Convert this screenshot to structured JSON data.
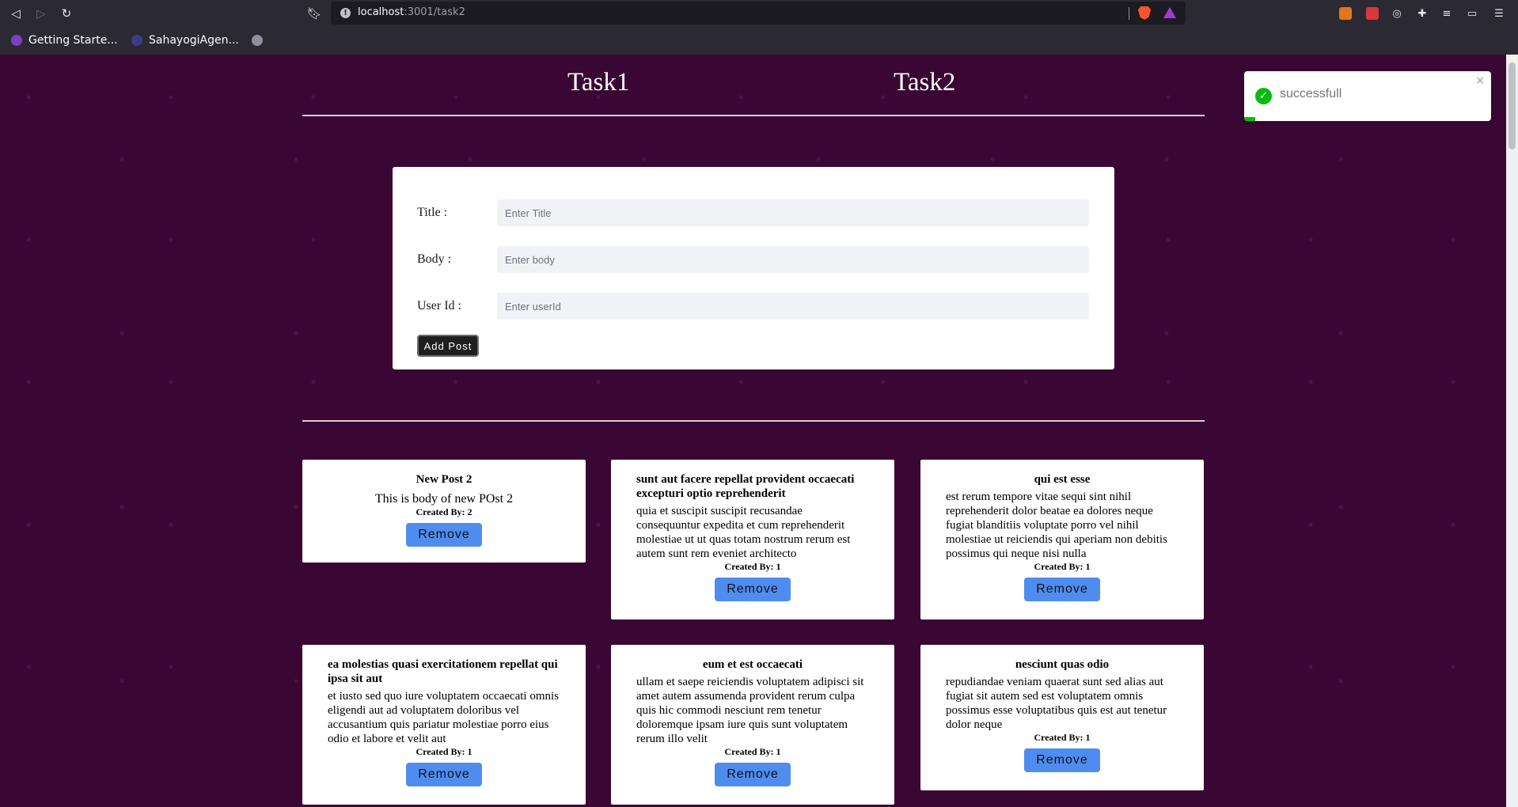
{
  "browser": {
    "url_host": "localhost",
    "url_path": ":3001/task2",
    "bookmarks": [
      "Getting Starte...",
      "SahayogiAgen..."
    ]
  },
  "nav": {
    "task1": "Task1",
    "task2": "Task2"
  },
  "form": {
    "title_label": "Title :",
    "title_placeholder": "Enter Title",
    "body_label": "Body :",
    "body_placeholder": "Enter body",
    "userid_label": "User Id :",
    "userid_placeholder": "Enter userId",
    "submit_label": "Add Post"
  },
  "posts": [
    {
      "title": "New Post 2",
      "body": "This is body of new POst 2",
      "created_by": "Created By: 2",
      "remove": "Remove"
    },
    {
      "title": "sunt aut facere repellat provident occaecati excepturi optio reprehenderit",
      "body": "quia et suscipit suscipit recusandae consequuntur expedita et cum reprehenderit molestiae ut ut quas totam nostrum rerum est autem sunt rem eveniet architecto",
      "created_by": "Created By: 1",
      "remove": "Remove"
    },
    {
      "title": "qui est esse",
      "body": "est rerum tempore vitae sequi sint nihil reprehenderit dolor beatae ea dolores neque fugiat blanditiis voluptate porro vel nihil molestiae ut reiciendis qui aperiam non debitis possimus qui neque nisi nulla",
      "created_by": "Created By: 1",
      "remove": "Remove"
    },
    {
      "title": "ea molestias quasi exercitationem repellat qui ipsa sit aut",
      "body": "et iusto sed quo iure voluptatem occaecati omnis eligendi aut ad voluptatem doloribus vel accusantium quis pariatur molestiae porro eius odio et labore et velit aut",
      "created_by": "Created By: 1",
      "remove": "Remove"
    },
    {
      "title": "eum et est occaecati",
      "body": "ullam et saepe reiciendis voluptatem adipisci sit amet autem assumenda provident rerum culpa quis hic commodi nesciunt rem tenetur doloremque ipsam iure quis sunt voluptatem rerum illo velit",
      "created_by": "Created By: 1",
      "remove": "Remove"
    },
    {
      "title": "nesciunt quas odio",
      "body": "repudiandae veniam quaerat sunt sed alias aut fugiat sit autem sed est voluptatem omnis possimus esse voluptatibus quis est aut tenetur dolor neque",
      "created_by": "Created By: 1",
      "remove": "Remove"
    }
  ],
  "toast": {
    "message": "successfull",
    "close": "×"
  },
  "colors": {
    "page_bg": "#3a0734",
    "remove_button": "#4f8cf0",
    "toast_success": "#07bc0c"
  }
}
